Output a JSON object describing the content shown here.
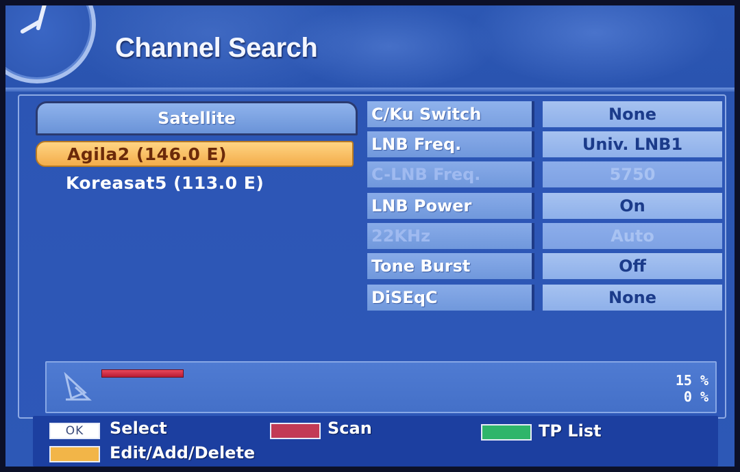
{
  "header": {
    "title": "Channel Search"
  },
  "satellite_list": {
    "header": "Satellite",
    "items": [
      {
        "label": "Agila2 (146.0 E)",
        "selected": true
      },
      {
        "label": "Koreasat5 (113.0 E)",
        "selected": false
      }
    ]
  },
  "settings": [
    {
      "label": "C/Ku Switch",
      "value": "None",
      "enabled": true
    },
    {
      "label": "LNB Freq.",
      "value": "Univ. LNB1",
      "enabled": true
    },
    {
      "label": "C-LNB Freq.",
      "value": "5750",
      "enabled": false
    },
    {
      "label": "LNB Power",
      "value": "On",
      "enabled": true
    },
    {
      "label": "22KHz",
      "value": "Auto",
      "enabled": false
    },
    {
      "label": "Tone Burst",
      "value": "Off",
      "enabled": true
    },
    {
      "label": "DiSEqC",
      "value": "None",
      "enabled": true
    }
  ],
  "signal": {
    "strength_percent": 15,
    "quality_percent": 0,
    "strength_text": "15 %",
    "quality_text": "0 %"
  },
  "footer": {
    "ok_key": "OK",
    "select_label": "Select",
    "scan_label": "Scan",
    "tp_list_label": "TP List",
    "edit_label": "Edit/Add/Delete"
  },
  "colors": {
    "red_key": "#c23a55",
    "green_key": "#2fb56a",
    "yellow_key": "#f2b548"
  }
}
